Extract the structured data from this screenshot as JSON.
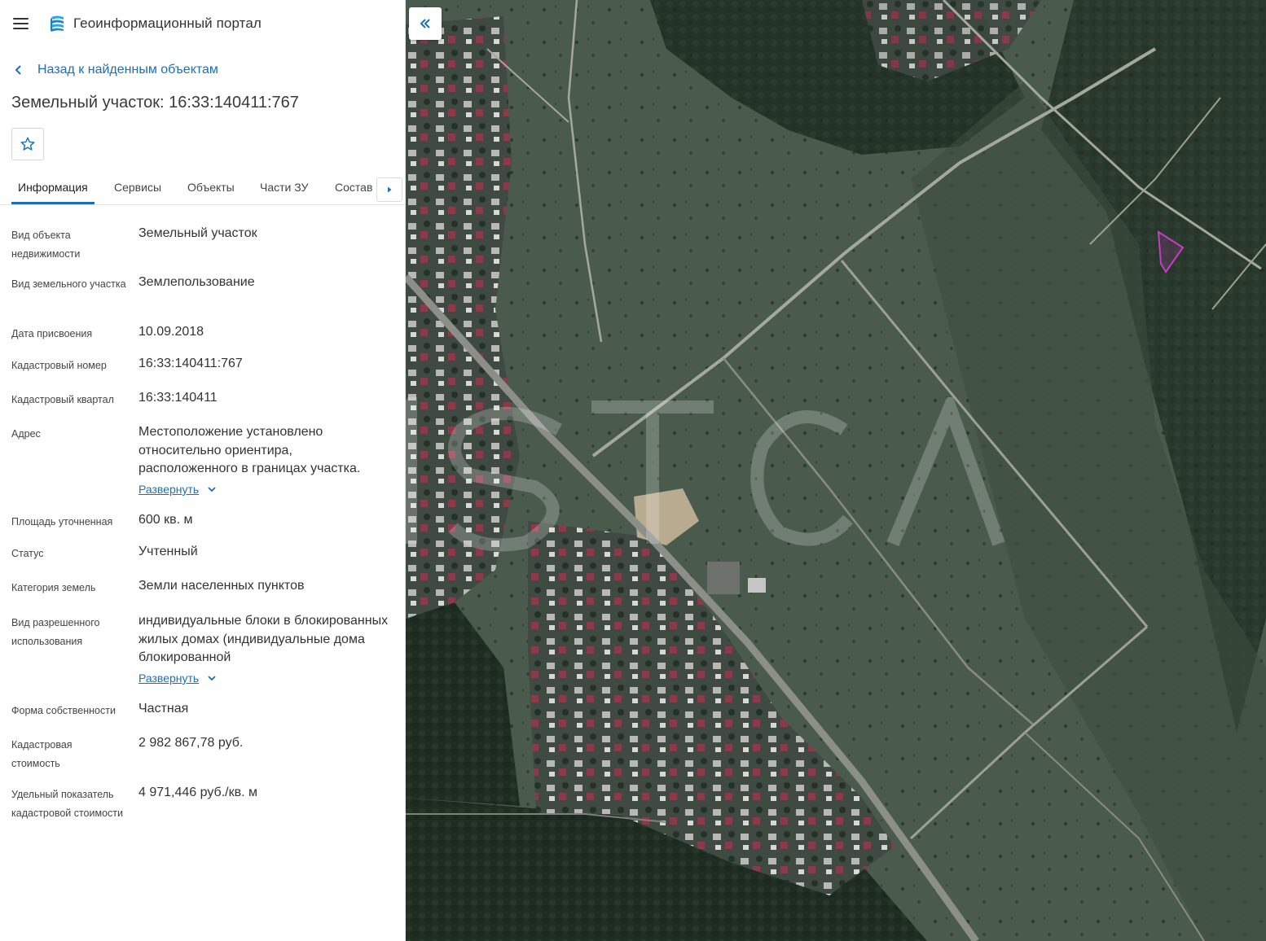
{
  "header": {
    "app_title": "Геоинформационный портал",
    "menu_icon": "menu-icon",
    "logo_icon": "portal-logo-icon"
  },
  "nav": {
    "back_label": "Назад к найденным объектам"
  },
  "object": {
    "title": "Земельный участок: 16:33:140411:767"
  },
  "tabs": [
    {
      "label": "Информация",
      "active": true
    },
    {
      "label": "Сервисы",
      "active": false
    },
    {
      "label": "Объекты",
      "active": false
    },
    {
      "label": "Части ЗУ",
      "active": false
    },
    {
      "label": "Состав",
      "active": false
    }
  ],
  "fields": [
    {
      "label": "Вид объекта недвижимости",
      "value": "Земельный участок"
    },
    {
      "label": "Вид земельного участка",
      "value": "Землепользование"
    },
    {
      "label": "Дата присвоения",
      "value": "10.09.2018"
    },
    {
      "label": "Кадастровый номер",
      "value": "16:33:140411:767"
    },
    {
      "label": "Кадастровый квартал",
      "value": "16:33:140411"
    },
    {
      "label": "Адрес",
      "value": "Местоположение установлено относительно ориентира, расположенного в границах участка.",
      "expand": "Развернуть"
    },
    {
      "label": "Площадь уточненная",
      "value": "600 кв. м"
    },
    {
      "label": "Статус",
      "value": "Учтенный"
    },
    {
      "label": "Категория земель",
      "value": "Земли населенных пунктов"
    },
    {
      "label": "Вид разрешенного использования",
      "value": "индивидуальные блоки в блокированных жилых домах (индивидуальные дома блокированной",
      "expand": "Развернуть"
    },
    {
      "label": "Форма собственности",
      "value": "Частная"
    },
    {
      "label": "Кадастровая стоимость",
      "value": "2 982 867,78 руб."
    },
    {
      "label": "Удельный показатель кадастровой стоимости",
      "value": "4 971,446 руб./кв. м"
    }
  ],
  "map": {
    "collapse_icon": "double-chevron-left-icon",
    "parcel_color": "#c43fc4"
  }
}
